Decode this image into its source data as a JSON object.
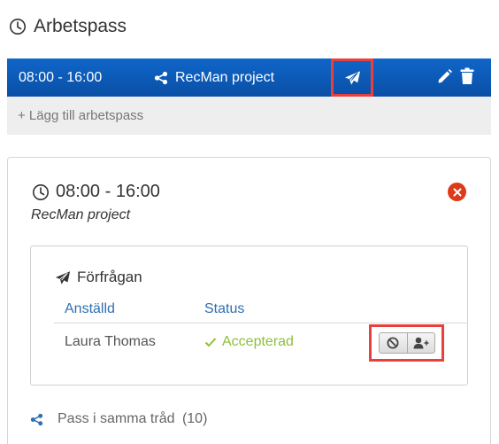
{
  "header": {
    "title": "Arbetspass",
    "icon": "clock-icon"
  },
  "shift_bar": {
    "time": "08:00 - 16:00",
    "project": "RecMan project",
    "project_icon": "share-icon",
    "send_icon": "paper-plane-icon",
    "edit_icon": "pencil-icon",
    "delete_icon": "trash-icon",
    "bar_color": "#0a59b8",
    "highlight_color": "#e8413d"
  },
  "add_shift": {
    "label": "+ Lägg till arbetspass"
  },
  "detail": {
    "time": "08:00 - 16:00",
    "project": "RecMan project",
    "close_icon": "close-circle-icon",
    "close_color": "#dd3a1a",
    "request": {
      "title": "Förfrågan",
      "title_icon": "paper-plane-icon",
      "columns": [
        "Anställd",
        "Status"
      ],
      "rows": [
        {
          "employee": "Laura Thomas",
          "status": "Accepterad",
          "status_color": "#8fbf3a",
          "actions": [
            "ban-icon",
            "user-plus-icon"
          ]
        }
      ]
    },
    "thread": {
      "label": "Pass i samma tråd",
      "count": "(10)",
      "icon": "share-icon"
    }
  }
}
